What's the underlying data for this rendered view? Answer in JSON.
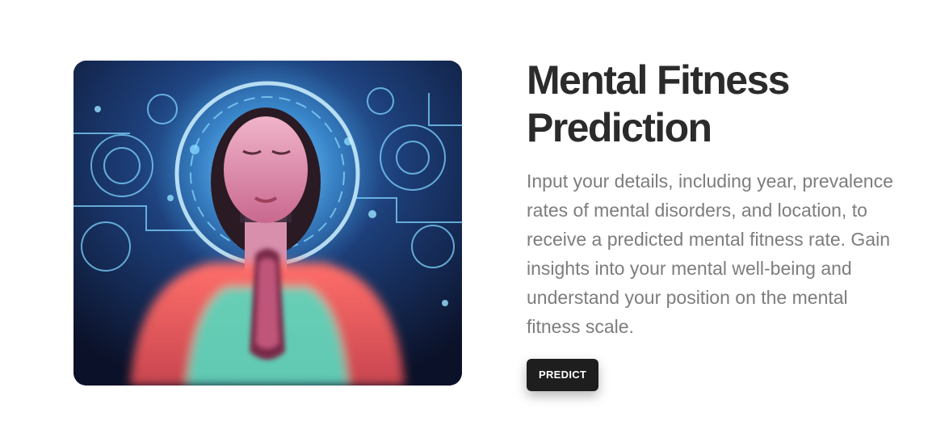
{
  "hero": {
    "image_alt": "Woman meditating with glowing digital gears",
    "title": "Mental Fitness Prediction",
    "description": "Input your details, including year, prevalence rates of mental disorders, and location, to receive a predicted mental fitness rate. Gain insights into your mental well-being and understand your position on the mental fitness scale.",
    "button_label": "PREDICT"
  },
  "colors": {
    "title": "#2b2b2b",
    "text": "#7d7d7d",
    "button_bg": "#1e1e1e",
    "button_text": "#ffffff"
  }
}
